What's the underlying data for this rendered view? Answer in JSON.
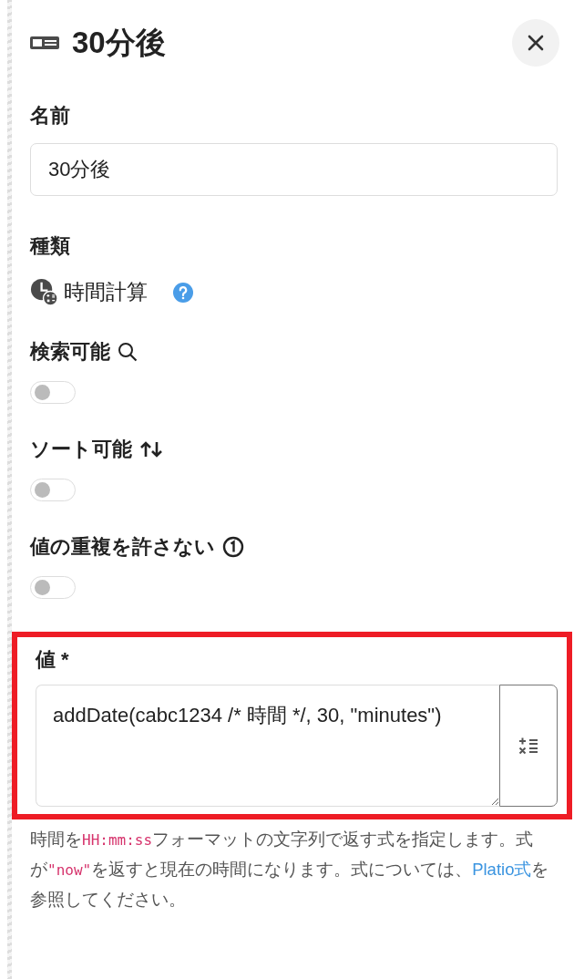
{
  "header": {
    "title": "30分後"
  },
  "name_field": {
    "label": "名前",
    "value": "30分後"
  },
  "type_field": {
    "label": "種類",
    "value": "時間計算"
  },
  "searchable": {
    "label": "検索可能",
    "on": false
  },
  "sortable": {
    "label": "ソート可能",
    "on": false
  },
  "unique": {
    "label": "値の重複を許さない",
    "on": false
  },
  "value_field": {
    "label": "値 *",
    "highlighted": true,
    "value": "addDate(cabc1234 /* 時間 */, 30, \"minutes\")",
    "help": [
      {
        "kind": "text",
        "text": "時間を"
      },
      {
        "kind": "code",
        "text": "HH:mm:ss"
      },
      {
        "kind": "text",
        "text": "フォーマットの文字列で返す式を指定します。式が"
      },
      {
        "kind": "code",
        "text": "\"now\""
      },
      {
        "kind": "text",
        "text": "を返すと現在の時間になります。式については、"
      },
      {
        "kind": "link",
        "text": "Platio式"
      },
      {
        "kind": "text",
        "text": "を参照してください。"
      }
    ]
  }
}
